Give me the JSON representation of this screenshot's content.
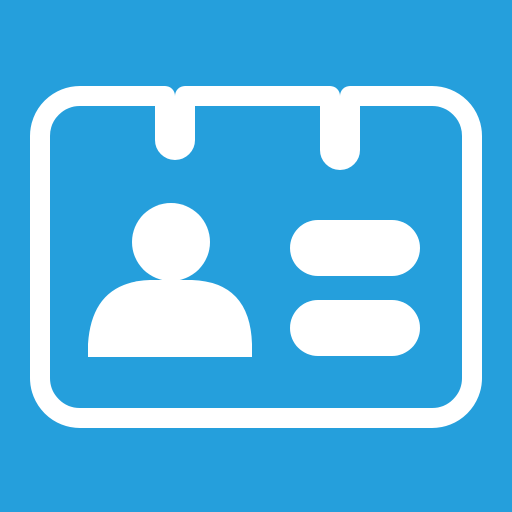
{
  "tile": {
    "background_color": "#259FDC",
    "foreground_color": "#FFFFFF"
  },
  "icon": {
    "name": "contact-card-icon",
    "parts": [
      "id-card-outline",
      "person-silhouette",
      "text-lines"
    ]
  }
}
